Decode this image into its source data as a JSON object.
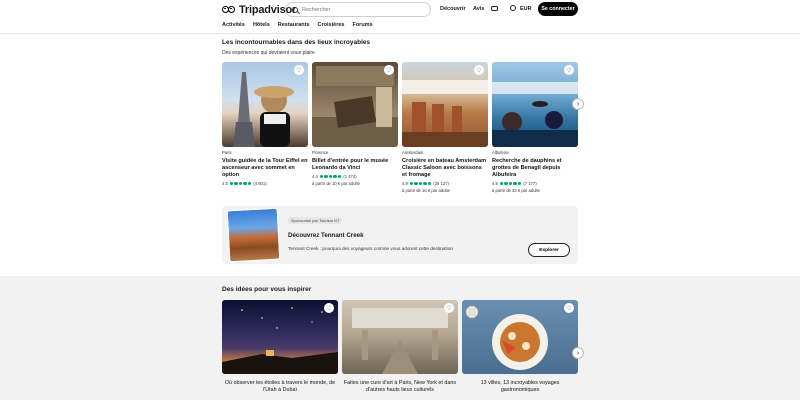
{
  "brand": {
    "name": "Tripadvisor"
  },
  "search": {
    "placeholder": "Rechercher"
  },
  "topnav": {
    "discover": "Découvrir",
    "reviews": "Avis",
    "currency": "EUR",
    "login": "Se connecter"
  },
  "subnav": [
    "Activités",
    "Hôtels",
    "Restaurants",
    "Croisières",
    "Forums"
  ],
  "section1": {
    "title": "Les incontournables dans des lieux incroyables",
    "subtitle": "Des expériences qui devraient vous plaire",
    "cards": [
      {
        "location": "Paris",
        "title": "Visite guidée de la Tour Eiffel en ascenseur avec sommet en option",
        "rating": "4.5",
        "reviews": "(4 801)",
        "price": ""
      },
      {
        "location": "Florence",
        "title": "Billet d'entrée pour le musée Leonardo da Vinci",
        "rating": "4.4",
        "reviews": "(1 474)",
        "price": "à partir de 10 € par adulte"
      },
      {
        "location": "Amsterdam",
        "title": "Croisière en bateau Amsterdam Classic Saloon avec boissons et fromage",
        "rating": "4.9",
        "reviews": "(29 127)",
        "price": "à partir de 16 € par adulte"
      },
      {
        "location": "Albufeira",
        "title": "Recherche de dauphins et grottes de Benagil depuis Albufeira",
        "rating": "4.9",
        "reviews": "(7 177)",
        "price": "à partir de 33 € par adulte"
      }
    ]
  },
  "sponsor": {
    "tag": "Sponsorisé par Tourism NT",
    "title": "Découvrez Tennant Creek",
    "description": "Tennant Creek : pourquoi des voyageurs comme vous adorent cette destination",
    "button": "Explorer"
  },
  "section2": {
    "title": "Des idées pour vous inspirer",
    "cards": [
      {
        "caption": "Où observer les étoiles à travers le monde, de l'Utah à Dubaï"
      },
      {
        "caption": "Faites une cure d'art à Paris, New York et dans d'autres hauts lieux culturels"
      },
      {
        "caption": "13 villes, 13 incroyables voyages gastronomiques"
      }
    ]
  },
  "colors": {
    "rating_green": "#00aa6c",
    "button_dark": "#000000"
  }
}
